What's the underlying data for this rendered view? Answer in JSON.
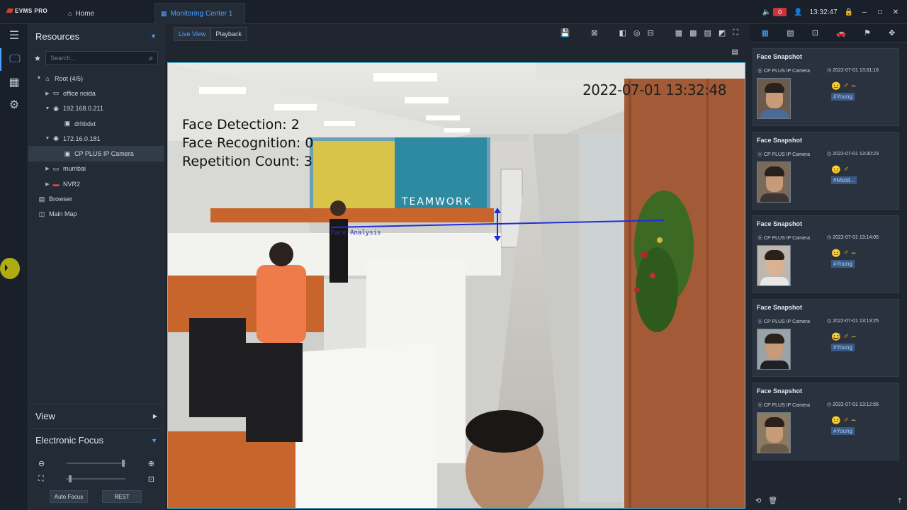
{
  "app": {
    "brand": "EVMS PRO",
    "tabs": [
      {
        "label": "Home",
        "icon": "home-icon"
      },
      {
        "label": "Monitoring Center 1",
        "icon": "grid-icon"
      }
    ],
    "alarm_count": "0",
    "clock": "13:32:47"
  },
  "resources": {
    "title": "Resources",
    "search_placeholder": "Search...",
    "tree": [
      {
        "label": "Root (4/5)",
        "icon": "org-icon",
        "expanded": true
      },
      {
        "label": "office noida",
        "icon": "device-icon"
      },
      {
        "label": "192.168.0.211",
        "icon": "camera-device-icon",
        "expanded": true
      },
      {
        "label": "drhbdxt",
        "icon": "channel-icon"
      },
      {
        "label": "172.16.0.181",
        "icon": "camera-device-icon",
        "expanded": true
      },
      {
        "label": "CP PLUS IP Camera",
        "icon": "channel-icon",
        "selected": true
      },
      {
        "label": "mumbai",
        "icon": "device-icon"
      },
      {
        "label": "NVR2",
        "icon": "nvr-icon"
      },
      {
        "label": "Browser",
        "icon": "browser-icon"
      },
      {
        "label": "Main Map",
        "icon": "map-icon"
      }
    ],
    "view_label": "View",
    "focus_label": "Electronic Focus",
    "auto_focus_label": "Auto Focus",
    "rest_label": "REST"
  },
  "main": {
    "view_tabs": [
      "Live View",
      "Playback"
    ],
    "video": {
      "timestamp": "2022-07-01 13:32:48",
      "stats": [
        "Face Detection: 2",
        "Face Recognition: 0",
        "Repetition Count: 3"
      ],
      "overlay_label": "Face Analysis",
      "signage_text": "TEAMWORK"
    }
  },
  "snapshots": [
    {
      "title": "Face Snapshot",
      "camera": "CP PLUS IP Camera",
      "time": "2022-07-01 13:31:16",
      "tag": "#Young",
      "emotion": "😐",
      "gender": "♂",
      "extra": "⌢"
    },
    {
      "title": "Face Snapshot",
      "camera": "CP PLUS IP Camera",
      "time": "2022-07-01 13:30:23",
      "tag": "#Middl...",
      "emotion": "😐",
      "gender": "♂",
      "extra": ""
    },
    {
      "title": "Face Snapshot",
      "camera": "CP PLUS IP Camera",
      "time": "2022-07-01 13:14:05",
      "tag": "#Young",
      "emotion": "😐",
      "gender": "♂",
      "extra": "⌢"
    },
    {
      "title": "Face Snapshot",
      "camera": "CP PLUS IP Camera",
      "time": "2022-07-01 13:13:25",
      "tag": "#Young",
      "emotion": "😅",
      "gender": "♂",
      "extra": "⌢"
    },
    {
      "title": "Face Snapshot",
      "camera": "CP PLUS IP Camera",
      "time": "2022-07-01 13:12:56",
      "tag": "#Young",
      "emotion": "😐",
      "gender": "♂",
      "extra": "⌢"
    }
  ],
  "colors": {
    "accent": "#4ea3ff",
    "alarm": "#c9353d",
    "video_border": "#52c7e8"
  }
}
